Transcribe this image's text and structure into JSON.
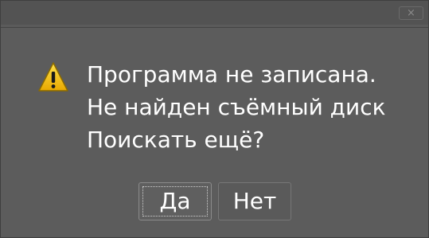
{
  "dialog": {
    "close_label": "×",
    "icon": "warning-icon",
    "message_lines": [
      "Программа не записана.",
      "Не найден съёмный диск",
      "Поискать ещё?"
    ],
    "buttons": {
      "yes_label": "Да",
      "no_label": "Нет"
    }
  },
  "colors": {
    "background": "#5b5b5b",
    "text": "#ffffff",
    "warning_yellow": "#f5c400"
  }
}
